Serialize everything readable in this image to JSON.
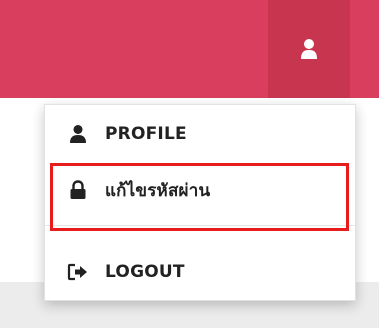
{
  "header": {
    "bar_color": "#d93e5f",
    "user_button_color": "#c8354f",
    "user_icon": "user-icon"
  },
  "menu": {
    "items": [
      {
        "label": "PROFILE",
        "icon": "user-icon"
      },
      {
        "label": "แก้ไขรหัสผ่าน",
        "icon": "lock-icon"
      },
      {
        "label": "LOGOUT",
        "icon": "sign-out-icon"
      }
    ]
  },
  "highlight": {
    "color": "#e81c1c"
  }
}
